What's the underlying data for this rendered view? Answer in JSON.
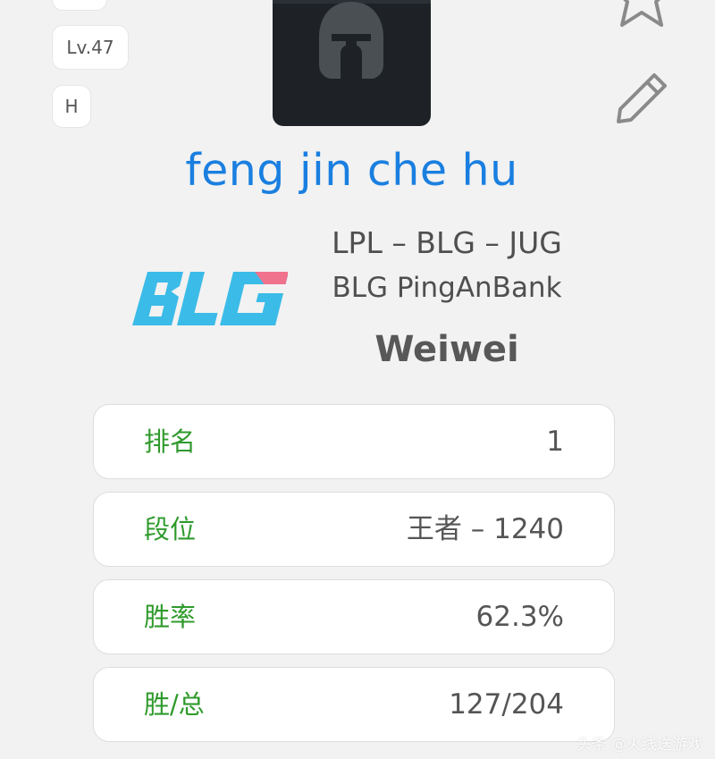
{
  "profile": {
    "top_pill_label": "",
    "level_label": "Lv.47",
    "rank_letter": "H",
    "avatar_icon": "spartan-helmet-icon",
    "star_icon": "star-icon",
    "edit_icon": "pencil-icon",
    "player_name": "feng jin che hu",
    "team_logo_text": "BLG",
    "league_line": "LPL – BLG – JUG",
    "team_name": "BLG PingAnBank",
    "real_name": "Weiwei"
  },
  "stats": [
    {
      "label": "排名",
      "value": "1"
    },
    {
      "label": "段位",
      "value": "王者 – 1240"
    },
    {
      "label": "胜率",
      "value": "62.3%"
    },
    {
      "label": "胜/总",
      "value": "127/204"
    }
  ],
  "watermark": "头条 @火线送游戏",
  "colors": {
    "name_blue": "#1a7fe0",
    "label_green": "#2f9a2c",
    "logo_blue": "#3bbbe8",
    "logo_pink": "#f0728c",
    "avatar_bg": "#1e2226"
  }
}
